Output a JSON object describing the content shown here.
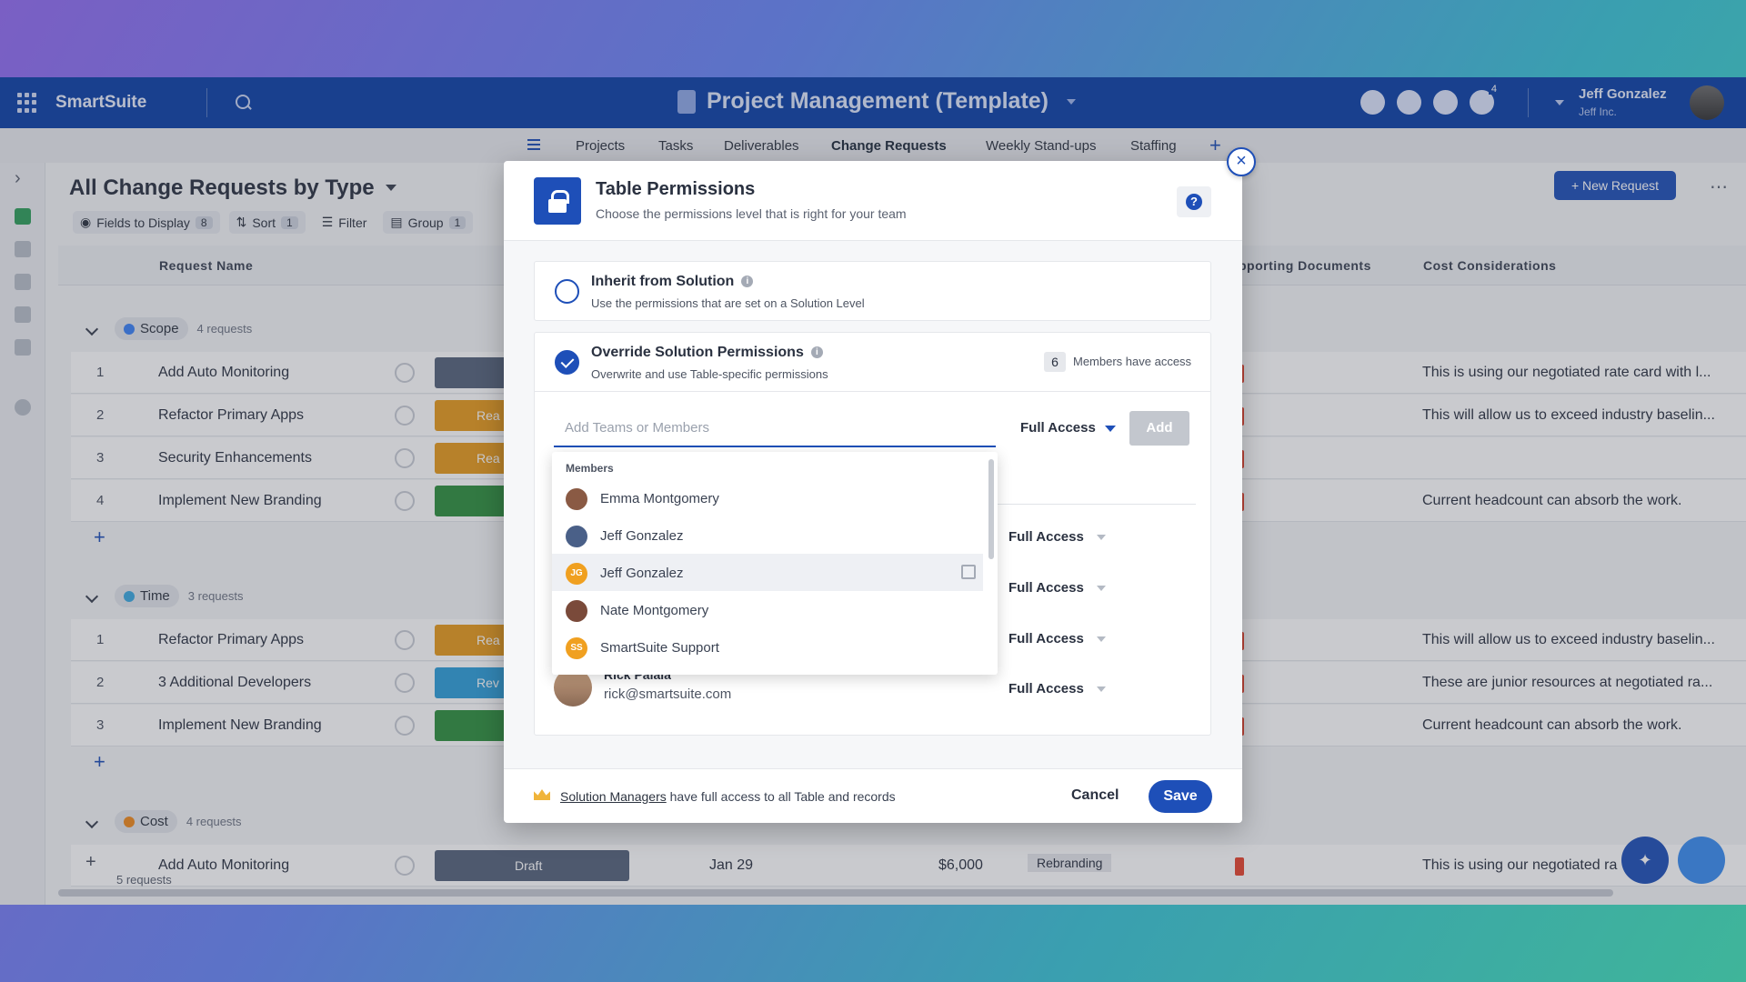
{
  "app": {
    "brand": "SmartSuite",
    "project_title": "Project Management (Template)",
    "notification_count": "4",
    "user_name": "Jeff Gonzalez",
    "user_org": "Jeff Inc."
  },
  "tabs": [
    {
      "label": "Projects"
    },
    {
      "label": "Tasks"
    },
    {
      "label": "Deliverables"
    },
    {
      "label": "Change Requests"
    },
    {
      "label": "Weekly Stand-ups"
    },
    {
      "label": "Staffing"
    }
  ],
  "view": {
    "title": "All Change Requests by Type",
    "new_button": "New Request",
    "toolbar": {
      "fields_label": "Fields to Display",
      "fields_count": "8",
      "sort_label": "Sort",
      "sort_count": "1",
      "filter_label": "Filter",
      "group_label": "Group",
      "group_count": "1"
    },
    "columns": {
      "request_name": "Request Name",
      "supporting_docs": "pporting Documents",
      "cost_considerations": "Cost Considerations"
    },
    "groups": [
      {
        "name": "Scope",
        "count": "4 requests",
        "color": "#3b82f6",
        "rows": [
          {
            "num": "1",
            "name": "Add Auto Monitoring",
            "cost": "This is using our negotiated rate card with l..."
          },
          {
            "num": "2",
            "name": "Refactor Primary Apps",
            "status": "Rea",
            "cost": "This will allow us to exceed industry baselin..."
          },
          {
            "num": "3",
            "name": "Security Enhancements",
            "status": "Rea",
            "cost": ""
          },
          {
            "num": "4",
            "name": "Implement New Branding",
            "cost": "Current headcount can absorb the work."
          }
        ]
      },
      {
        "name": "Time",
        "count": "3 requests",
        "color": "#3ba8e0",
        "rows": [
          {
            "num": "1",
            "name": "Refactor Primary Apps",
            "status": "Rea",
            "cost": "This will allow us to exceed industry baselin..."
          },
          {
            "num": "2",
            "name": "3 Additional Developers",
            "status": "Rev",
            "cost": "These are junior resources at negotiated ra..."
          },
          {
            "num": "3",
            "name": "Implement New Branding",
            "cost": "Current headcount can absorb the work."
          }
        ]
      },
      {
        "name": "Cost",
        "count": "4 requests",
        "color": "#f08a1c",
        "rows": [
          {
            "num": "",
            "name": "Add Auto Monitoring",
            "status": "Draft",
            "date": "Jan 29",
            "amount": "$6,000",
            "tag": "Rebranding",
            "cost": "This is using our negotiated ra"
          }
        ]
      }
    ],
    "footer_count": "5 requests"
  },
  "modal": {
    "title": "Table Permissions",
    "subtitle": "Choose the permissions level that is right for your team",
    "help": "?",
    "inherit": {
      "title": "Inherit from Solution",
      "subtitle": "Use the permissions that are set on a Solution Level"
    },
    "override": {
      "title": "Override Solution Permissions",
      "subtitle": "Overwrite and use Table-specific permissions",
      "member_count": "6",
      "member_text": "Members have access"
    },
    "add_input": {
      "value": "",
      "placeholder": "Add Teams or Members"
    },
    "access_select": "Full Access",
    "add_button": "Add",
    "permission_rows": [
      {
        "access": "Full Access"
      },
      {
        "access": "Full Access"
      },
      {
        "access": "Full Access"
      },
      {
        "access": "Full Access"
      }
    ],
    "visible_member": {
      "name": "Rick Palaia",
      "email": "rick@smartsuite.com"
    },
    "dropdown": {
      "header": "Members",
      "items": [
        {
          "name": "Emma Montgomery",
          "initials": "",
          "color": "#8a5a44"
        },
        {
          "name": "Jeff Gonzalez",
          "initials": "",
          "color": "#4a6088"
        },
        {
          "name": "Jeff Gonzalez",
          "initials": "JG",
          "color": "#f0a020"
        },
        {
          "name": "Nate Montgomery",
          "initials": "",
          "color": "#7a4a3a"
        },
        {
          "name": "SmartSuite Support",
          "initials": "SS",
          "color": "#f0a020"
        }
      ]
    },
    "footer": {
      "link": "Solution Managers",
      "text": "have full access to all Table and records",
      "cancel": "Cancel",
      "save": "Save"
    }
  }
}
